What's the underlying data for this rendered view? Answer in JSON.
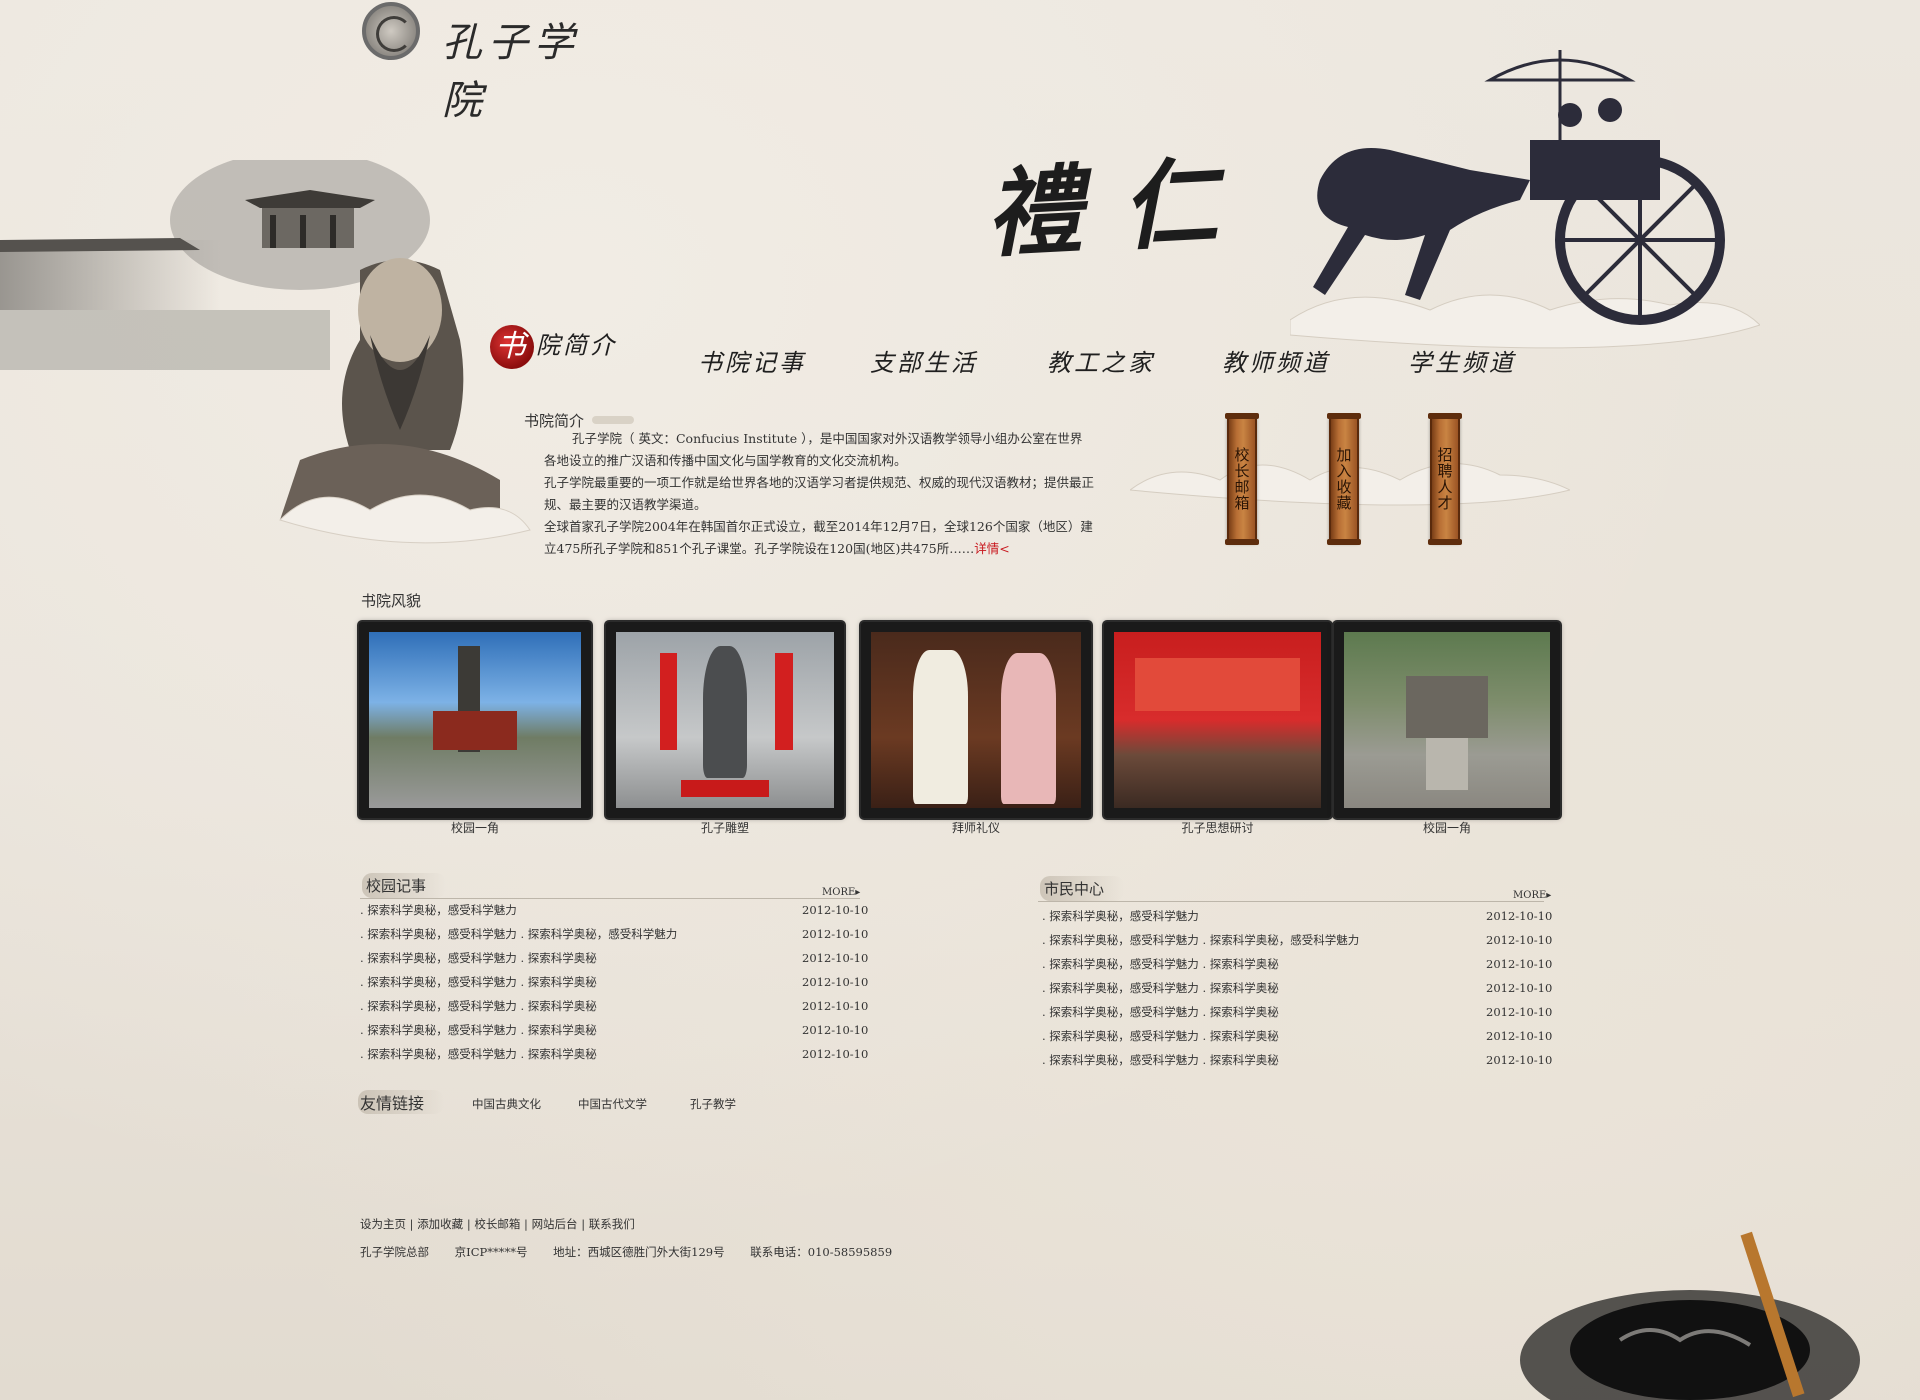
{
  "site": {
    "logo_text": "孔子学院"
  },
  "banner": {
    "calligraphy": "禮仁"
  },
  "nav": {
    "items": [
      {
        "first": "书",
        "label": "院简介"
      },
      {
        "label": "书院记事"
      },
      {
        "label": "支部生活"
      },
      {
        "label": "教工之家"
      },
      {
        "label": "教师频道"
      },
      {
        "label": "学生频道"
      }
    ]
  },
  "intro": {
    "title": "书院简介",
    "p1": "孔子学院（ 英文：Confucius Institute ），是中国国家对外汉语教学领导小组办公室在世界各地设立的推广汉语和传播中国文化与国学教育的文化交流机构。",
    "p2": "孔子学院最重要的一项工作就是给世界各地的汉语学习者提供规范、权威的现代汉语教材；提供最正规、最主要的汉语教学渠道。",
    "p3": "全球首家孔子学院2004年在韩国首尔正式设立，截至2014年12月7日，全球126个国家（地区）建立475所孔子学院和851个孔子课堂。孔子学院设在120国(地区)共475所……",
    "more": "详情<"
  },
  "plaques": [
    "校长邮箱",
    "加入收藏",
    "招聘人才"
  ],
  "gallery": {
    "title": "书院风貌",
    "items": [
      {
        "caption": "校园一角"
      },
      {
        "caption": "孔子雕塑"
      },
      {
        "caption": "拜师礼仪"
      },
      {
        "caption": "孔子思想研讨"
      },
      {
        "caption": "校园一角"
      }
    ]
  },
  "news_left": {
    "title": "校园记事",
    "more": "MORE▸",
    "rows": [
      {
        "title": ". 探索科学奥秘，感受科学魅力",
        "date": "2012-10-10"
      },
      {
        "title": ". 探索科学奥秘，感受科学魅力  . 探索科学奥秘，感受科学魅力",
        "date": "2012-10-10"
      },
      {
        "title": ". 探索科学奥秘，感受科学魅力  . 探索科学奥秘",
        "date": "2012-10-10"
      },
      {
        "title": ". 探索科学奥秘，感受科学魅力  . 探索科学奥秘",
        "date": "2012-10-10"
      },
      {
        "title": ". 探索科学奥秘，感受科学魅力  . 探索科学奥秘",
        "date": "2012-10-10"
      },
      {
        "title": ". 探索科学奥秘，感受科学魅力  . 探索科学奥秘",
        "date": "2012-10-10"
      },
      {
        "title": ". 探索科学奥秘，感受科学魅力  . 探索科学奥秘",
        "date": "2012-10-10"
      }
    ]
  },
  "news_right": {
    "title": "市民中心",
    "more": "MORE▸",
    "rows": [
      {
        "title": ". 探索科学奥秘，感受科学魅力",
        "date": "2012-10-10"
      },
      {
        "title": ". 探索科学奥秘，感受科学魅力  . 探索科学奥秘，感受科学魅力",
        "date": "2012-10-10"
      },
      {
        "title": ". 探索科学奥秘，感受科学魅力  . 探索科学奥秘",
        "date": "2012-10-10"
      },
      {
        "title": ". 探索科学奥秘，感受科学魅力  . 探索科学奥秘",
        "date": "2012-10-10"
      },
      {
        "title": ". 探索科学奥秘，感受科学魅力  . 探索科学奥秘",
        "date": "2012-10-10"
      },
      {
        "title": ". 探索科学奥秘，感受科学魅力  . 探索科学奥秘",
        "date": "2012-10-10"
      },
      {
        "title": ". 探索科学奥秘，感受科学魅力  . 探索科学奥秘",
        "date": "2012-10-10"
      }
    ]
  },
  "links": {
    "title": "友情链接",
    "items": [
      "中国古典文化",
      "中国古代文学",
      "孔子教学"
    ]
  },
  "footer": {
    "nav": [
      "设为主页",
      "添加收藏",
      "校长邮箱",
      "网站后台",
      "联系我们"
    ],
    "org": "孔子学院总部",
    "icp": "京ICP*****号",
    "address": "地址：西城区德胜门外大街129号",
    "phone": "联系电话：010-58595859"
  },
  "colors": {
    "accent_red": "#c8161d",
    "plaque_wood": "#b86f35",
    "paper": "#ece7df"
  }
}
